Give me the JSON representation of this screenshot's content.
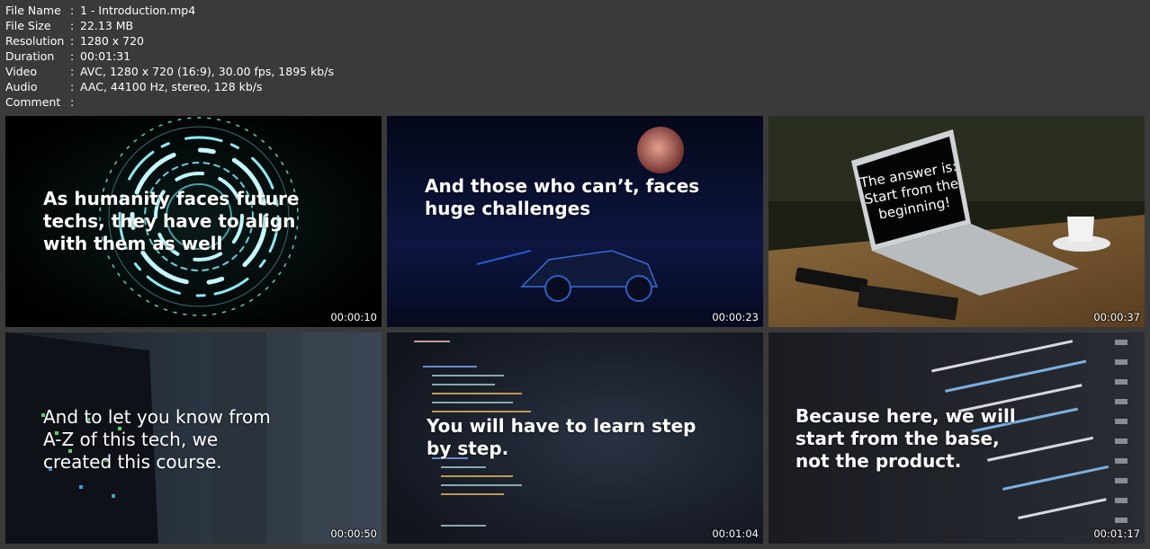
{
  "info": {
    "rows": [
      {
        "label": "File Name",
        "value": "1 - Introduction.mp4"
      },
      {
        "label": "File Size",
        "value": "22.13 MB"
      },
      {
        "label": "Resolution",
        "value": "1280 x 720"
      },
      {
        "label": "Duration",
        "value": "00:01:31"
      },
      {
        "label": "Video",
        "value": "AVC, 1280 x 720 (16:9), 30.00 fps, 1895 kb/s"
      },
      {
        "label": "Audio",
        "value": "AAC, 44100 Hz, stereo, 128 kb/s"
      },
      {
        "label": "Comment",
        "value": ""
      }
    ],
    "separator": ":"
  },
  "thumbnails": [
    {
      "caption": "As humanity faces future\ntechs, they have to align\nwith them as well",
      "timestamp": "00:00:10"
    },
    {
      "caption": "And those who can’t, faces\nhuge challenges",
      "timestamp": "00:00:23"
    },
    {
      "caption": "The answer is:\nStart from the\nbeginning!",
      "timestamp": "00:00:37"
    },
    {
      "caption": "And to let you know from\nA-Z of this tech, we\ncreated this course.",
      "timestamp": "00:00:50"
    },
    {
      "caption": "You will have to learn step\nby step.",
      "timestamp": "00:01:04"
    },
    {
      "caption": "Because here, we will\nstart from the base,\nnot the product.",
      "timestamp": "00:01:17"
    }
  ]
}
